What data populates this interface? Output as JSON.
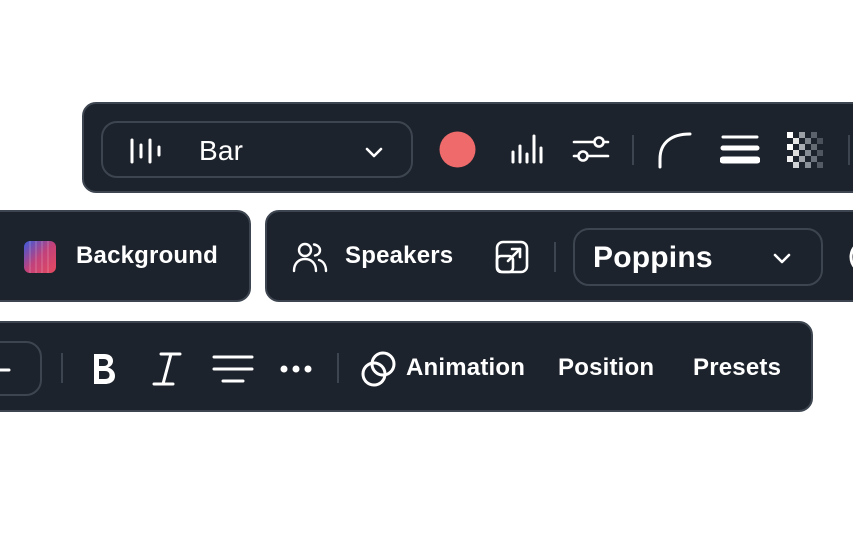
{
  "toolbar_top": {
    "style_select": {
      "value": "Bar",
      "icon": "waveform-bars-icon",
      "dropdown_icon": "chevron-down-icon"
    },
    "color_swatch": {
      "color": "#ef6b6b"
    },
    "tools": [
      "bar-chart-icon",
      "sliders-icon",
      "corner-radius-icon",
      "line-weight-icon",
      "transparency-icon"
    ]
  },
  "toolbar_middle": {
    "background_button": {
      "label": "Background",
      "icon": "gradient-swatch-icon"
    },
    "speakers_button": {
      "label": "Speakers",
      "icon": "users-icon"
    },
    "external_icon": "open-external-icon",
    "font_select": {
      "value": "Poppins",
      "dropdown_icon": "chevron-down-icon"
    }
  },
  "toolbar_bottom": {
    "format_tools": [
      "bold-icon",
      "italic-icon",
      "align-center-icon",
      "more-icon"
    ],
    "animation_button": {
      "label": "Animation",
      "icon": "animation-circles-icon"
    },
    "position_button": {
      "label": "Position"
    },
    "presets_button": {
      "label": "Presets"
    }
  },
  "colors": {
    "toolbar_bg": "#1d232c",
    "border": "#3d4550",
    "accent_red": "#ef6b6b"
  }
}
